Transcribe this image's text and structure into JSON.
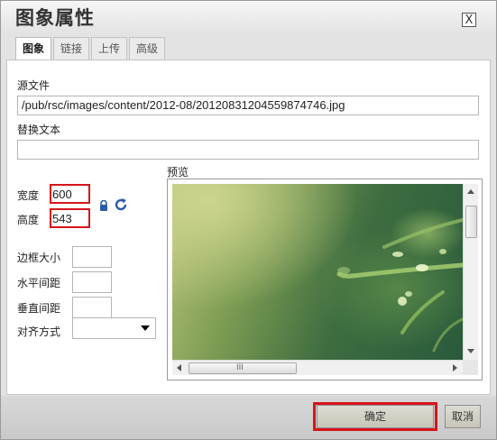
{
  "dialog": {
    "title": "图象属性",
    "close_label": "X"
  },
  "tabs": [
    {
      "label": "图象",
      "active": true
    },
    {
      "label": "链接",
      "active": false
    },
    {
      "label": "上传",
      "active": false
    },
    {
      "label": "高级",
      "active": false
    }
  ],
  "form": {
    "source_label": "源文件",
    "source_value": "/pub/rsc/images/content/2012-08/20120831204559874746.jpg",
    "alt_label": "替换文本",
    "alt_value": "",
    "width_label": "宽度",
    "width_value": "600",
    "height_label": "高度",
    "height_value": "543",
    "border_label": "边框大小",
    "hspace_label": "水平间距",
    "vspace_label": "垂直间距",
    "align_label": "对齐方式",
    "align_value": "",
    "preview_label": "预览"
  },
  "preview": {
    "scroll_grip": "III"
  },
  "footer": {
    "ok_label": "确定",
    "cancel_label": "取消"
  },
  "colors": {
    "highlight": "#d6141a",
    "dialog_bg": "#e3e3e3"
  }
}
